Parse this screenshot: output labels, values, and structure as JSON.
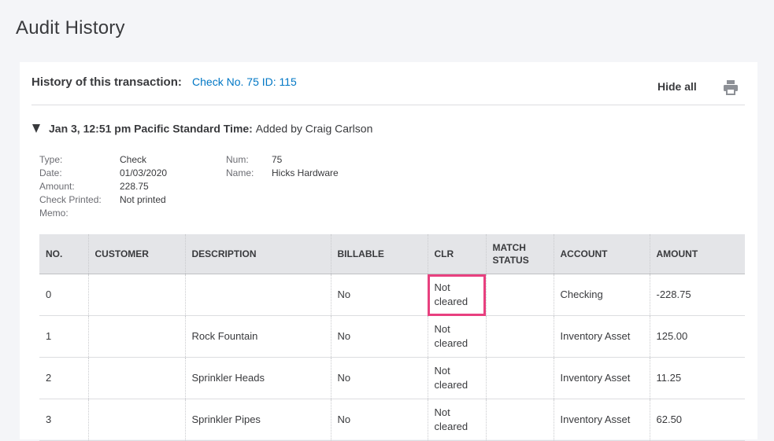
{
  "page": {
    "title": "Audit History"
  },
  "history": {
    "label": "History of this transaction:",
    "link": "Check No. 75 ID: 115",
    "hide_all": "Hide all"
  },
  "entry": {
    "when": "Jan 3, 12:51 pm Pacific Standard Time:",
    "what": "Added by Craig Carlson"
  },
  "details": {
    "left": [
      {
        "k": "Type:",
        "v": "Check"
      },
      {
        "k": "Date:",
        "v": "01/03/2020"
      },
      {
        "k": "Amount:",
        "v": "228.75"
      },
      {
        "k": "Check Printed:",
        "v": "Not printed"
      },
      {
        "k": "Memo:",
        "v": ""
      }
    ],
    "right": [
      {
        "k": "Num:",
        "v": "75"
      },
      {
        "k": "Name:",
        "v": "Hicks Hardware"
      }
    ]
  },
  "table": {
    "headers": [
      "NO.",
      "CUSTOMER",
      "DESCRIPTION",
      "BILLABLE",
      "CLR",
      "MATCH STATUS",
      "ACCOUNT",
      "AMOUNT"
    ],
    "rows": [
      [
        "0",
        "",
        "",
        "No",
        "Not cleared",
        "",
        "Checking",
        "-228.75"
      ],
      [
        "1",
        "",
        "Rock Fountain",
        "No",
        "Not cleared",
        "",
        "Inventory Asset",
        "125.00"
      ],
      [
        "2",
        "",
        "Sprinkler Heads",
        "No",
        "Not cleared",
        "",
        "Inventory Asset",
        "11.25"
      ],
      [
        "3",
        "",
        "Sprinkler Pipes",
        "No",
        "Not cleared",
        "",
        "Inventory Asset",
        "62.50"
      ]
    ]
  },
  "colors": {
    "link": "#0077c5",
    "highlight": "#e8407f",
    "header_bg": "#e4e5e8"
  }
}
